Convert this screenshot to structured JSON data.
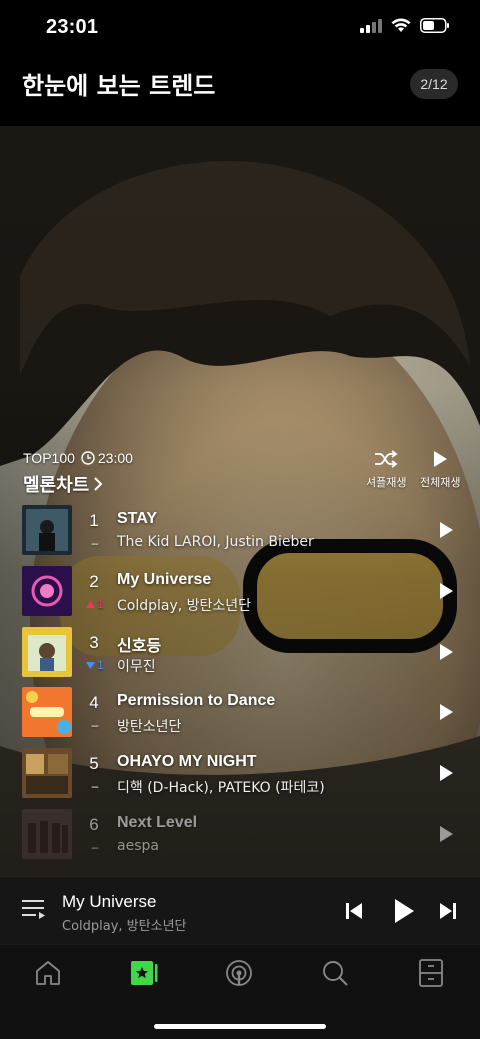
{
  "status": {
    "time": "23:01"
  },
  "header": {
    "title": "한눈에 보는 트렌드",
    "page": "2/12"
  },
  "chart": {
    "label": "TOP100",
    "update_time": "23:00",
    "title": "멜론차트",
    "shuffle_label": "셔플재생",
    "play_all_label": "전체재생"
  },
  "tracks": [
    {
      "rank": "1",
      "title": "STAY",
      "artist": "The Kid LAROI, Justin Bieber",
      "change": "–",
      "direction": "none"
    },
    {
      "rank": "2",
      "title": "My Universe",
      "artist": "Coldplay, 방탄소년단",
      "change": "1",
      "direction": "up"
    },
    {
      "rank": "3",
      "title": "신호등",
      "artist": "이무진",
      "change": "1",
      "direction": "down"
    },
    {
      "rank": "4",
      "title": "Permission to Dance",
      "artist": "방탄소년단",
      "change": "–",
      "direction": "none"
    },
    {
      "rank": "5",
      "title": "OHAYO MY NIGHT",
      "artist": "디핵 (D-Hack), PATEKO (파테코)",
      "change": "–",
      "direction": "none"
    },
    {
      "rank": "6",
      "title": "Next Level",
      "artist": "aespa",
      "change": "–",
      "direction": "none"
    }
  ],
  "now_playing": {
    "title": "My Universe",
    "artist": "Coldplay, 방탄소년단"
  },
  "colors": {
    "accent": "#3fd84a",
    "up": "#e8395a",
    "down": "#4a8ff0"
  },
  "tabs": [
    {
      "name": "home-icon",
      "active": false
    },
    {
      "name": "melon-chart-icon",
      "active": true
    },
    {
      "name": "podcast-icon",
      "active": false
    },
    {
      "name": "search-icon",
      "active": false
    },
    {
      "name": "library-icon",
      "active": false
    }
  ]
}
